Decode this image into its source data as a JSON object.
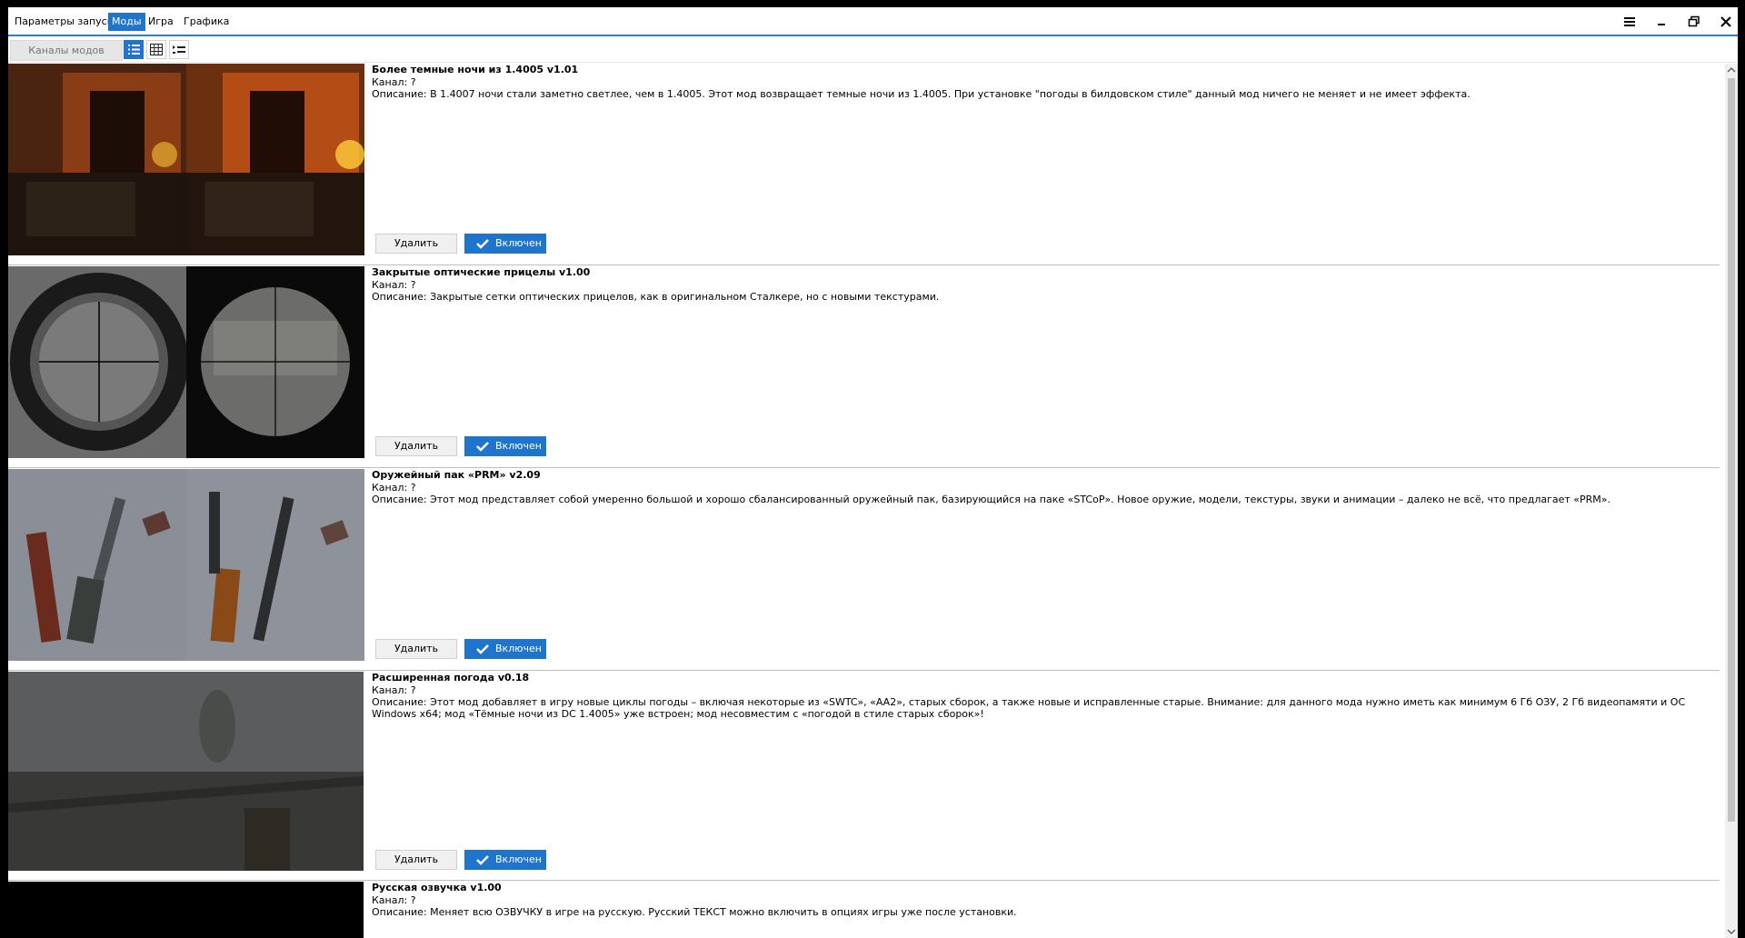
{
  "menu": {
    "tabs": [
      {
        "label": "Параметры запуска"
      },
      {
        "label": "Моды"
      },
      {
        "label": "Игра"
      },
      {
        "label": "Графика"
      }
    ],
    "active_tab": "Моды"
  },
  "window_controls": [
    "hamburger-icon",
    "minimize-icon",
    "restore-icon",
    "close-icon"
  ],
  "toolbar": {
    "channels_label": "Каналы модов",
    "views": [
      "list-view-icon",
      "grid-view-icon",
      "compact-list-icon"
    ],
    "active_view": "list-view-icon"
  },
  "colors": {
    "accent": "#1f75cc",
    "separator": "#bfbfbf"
  },
  "mods": [
    {
      "title": "Более темные ночи из 1.4005 v1.01",
      "channel": "Канал: ?",
      "description": "Описание: В 1.4007 ночи стали заметно светлее, чем в 1.4005. Этот мод возвращает темные ночи из 1.4005. При установке \"погоды в билдовском стиле\" данный мод ничего не меняет и не имеет эффекта.",
      "delete_label": "Удалить",
      "enabled_label": "Включен"
    },
    {
      "title": "Закрытые оптические прицелы v1.00",
      "channel": "Канал: ?",
      "description": "Описание: Закрытые сетки оптических прицелов, как в оригинальном Сталкере, но с новыми текстурами.",
      "delete_label": "Удалить",
      "enabled_label": "Включен"
    },
    {
      "title": "Оружейный пак «PRM» v2.09",
      "channel": "Канал: ?",
      "description": "Описание: Этот мод представляет собой умеренно большой и хорошо сбалансированный оружейный пак, базирующийся на паке «STCoP». Новое оружие, модели, текстуры, звуки и анимации – далеко не всё, что предлагает «PRM».",
      "delete_label": "Удалить",
      "enabled_label": "Включен"
    },
    {
      "title": "Расширенная погода v0.18",
      "channel": "Канал: ?",
      "description": "Описание: Этот мод добавляет в игру новые циклы погоды – включая некоторые из «SWTC», «AA2», старых сборок, а также новые и исправленные старые. Внимание: для данного мода нужно иметь как минимум 6 Гб ОЗУ, 2 Гб видеопамяти и ОС Windows x64; мод «Тёмные ночи из DC 1.4005» уже встроен; мод несовместим с «погодой в стиле старых сборок»!",
      "delete_label": "Удалить",
      "enabled_label": "Включен"
    },
    {
      "title": "Русская озвучка v1.00",
      "channel": "Канал: ?",
      "description": "Описание: Меняет всю ОЗВУЧКУ в игре на русскую. Русский ТЕКСТ можно включить в опциях игры уже после установки."
    }
  ]
}
